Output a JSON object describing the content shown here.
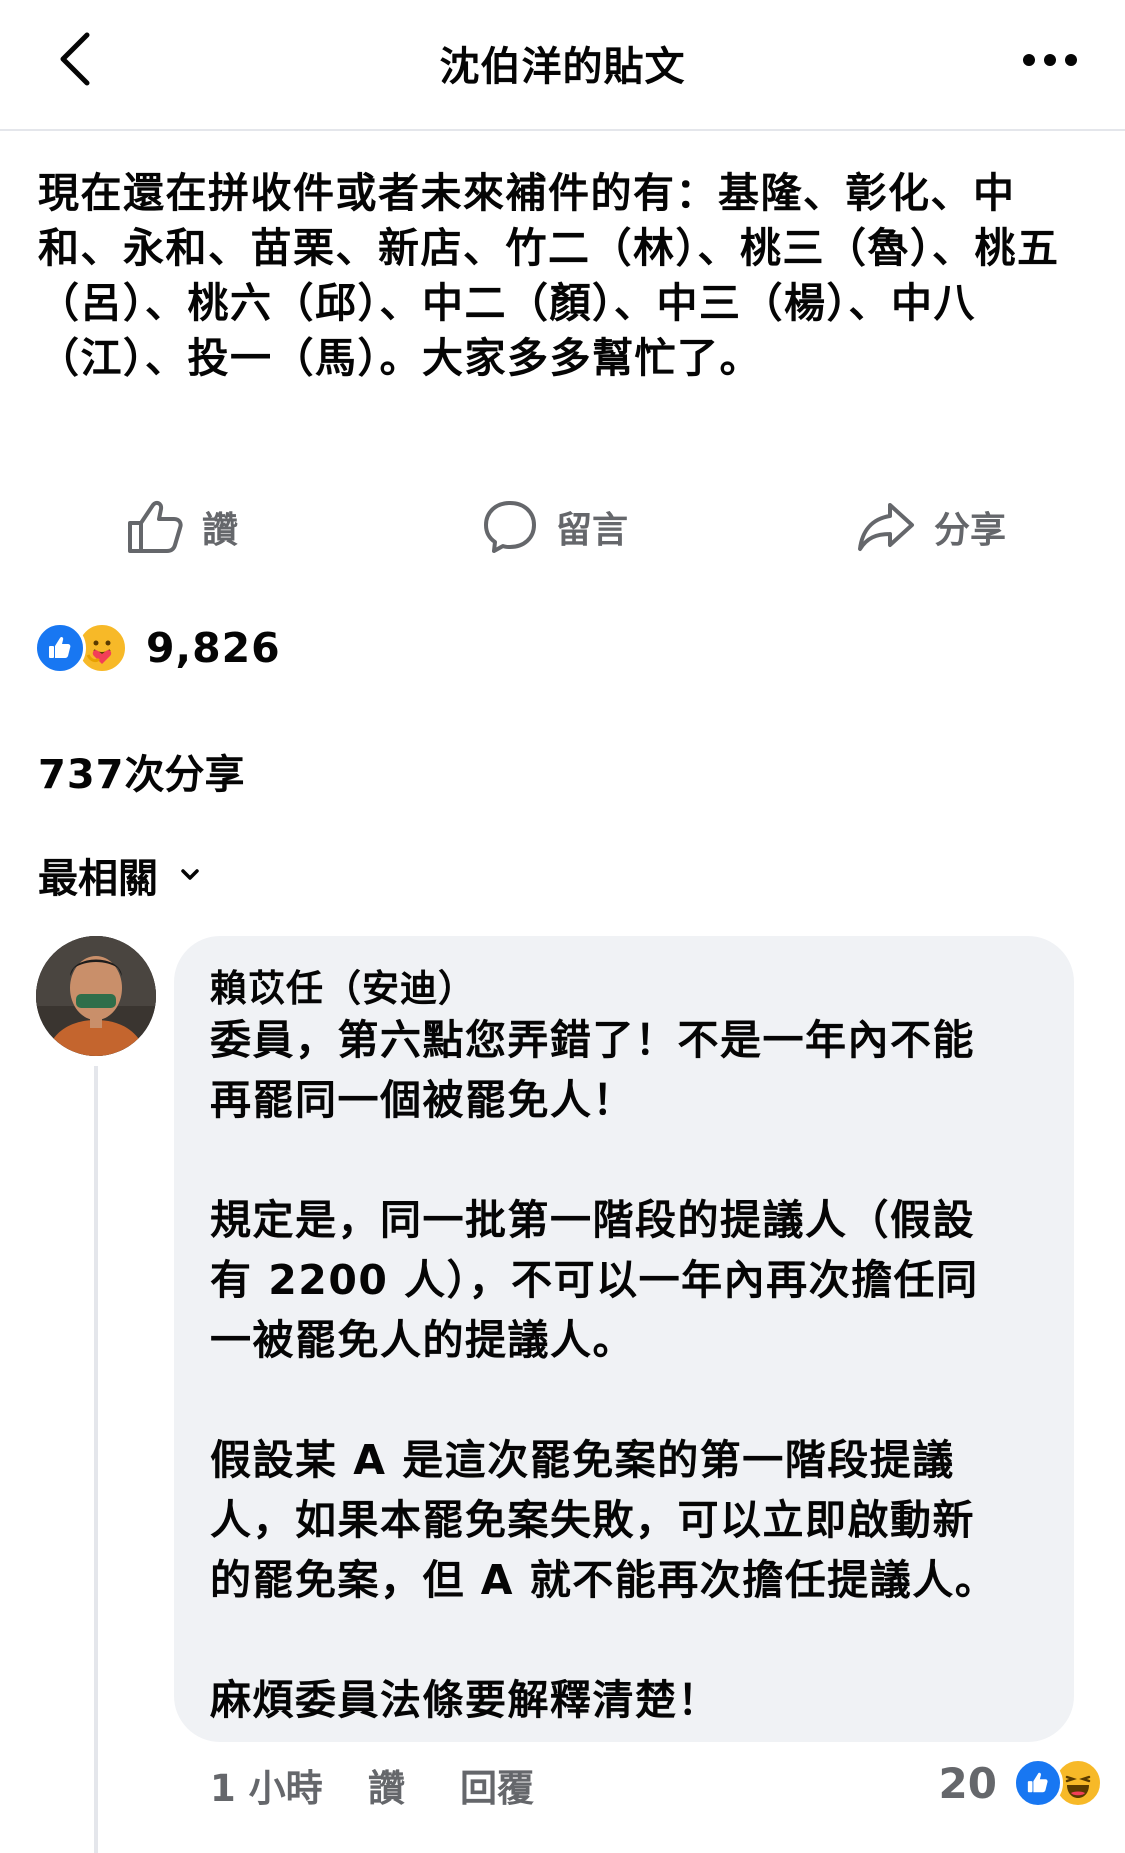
{
  "header": {
    "title": "沈伯洋的貼文",
    "back_icon": "chevron-left-icon",
    "more_icon": "more-dots-icon"
  },
  "post": {
    "text": "現在還在拼收件或者未來補件的有：基隆、彰化、中和、永和、苗栗、新店、竹二（林）、桃三（魯）、桃五（呂）、桃六（邱）、中二（顏）、中三（楊）、中八（江）、投一（馬）。大家多多幫忙了。"
  },
  "actions": {
    "like_label": "讚",
    "comment_label": "留言",
    "share_label": "分享"
  },
  "reactions": {
    "count": "9,826",
    "icons": [
      "like-reaction-icon",
      "care-reaction-icon"
    ]
  },
  "shares": {
    "count": "737",
    "label": "次分享"
  },
  "sort": {
    "label": "最相關"
  },
  "comment": {
    "author": "賴苡任（安迪）",
    "body": "委員，第六點您弄錯了！不是一年內不能\n再罷同一個被罷免人！\n\n規定是，同一批第一階段的提議人（假設\n有 2200 人），不可以一年內再次擔任同\n一被罷免人的提議人。\n\n假設某 A 是這次罷免案的第一階段提議\n人，如果本罷免案失敗，可以立即啟動新\n的罷免案，但 A 就不能再次擔任提議人。\n\n麻煩委員法條要解釋清楚！",
    "time": "1 小時",
    "like_label": "讚",
    "reply_label": "回覆",
    "reaction_count": "20",
    "reaction_icons": [
      "like-reaction-icon",
      "haha-reaction-icon"
    ]
  },
  "colors": {
    "text": "#050505",
    "secondary": "#65676b",
    "like_blue": "#1877f2",
    "bubble": "#f0f2f5",
    "divider": "#e4e6eb"
  }
}
